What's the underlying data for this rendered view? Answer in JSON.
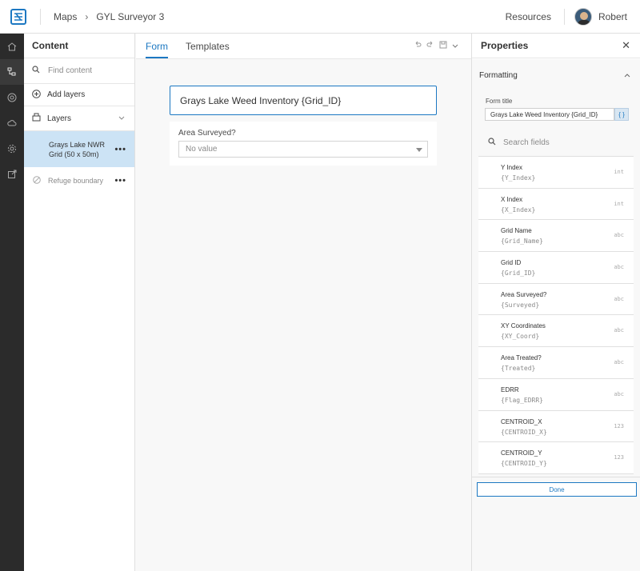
{
  "header": {
    "breadcrumb": [
      "Maps",
      "GYL Surveyor 3"
    ],
    "resources_label": "Resources",
    "username": "Robert"
  },
  "rail": {
    "icons": [
      "home-icon",
      "layers-icon",
      "target-icon",
      "cloud-icon",
      "gear-icon",
      "share-icon"
    ]
  },
  "content": {
    "title": "Content",
    "search_placeholder": "Find content",
    "add_layers_label": "Add layers",
    "layers_label": "Layers",
    "layers": [
      {
        "name": "Grays Lake NWR Grid (50 x 50m)",
        "selected": true
      },
      {
        "name": "Refuge boundary",
        "selected": false
      }
    ]
  },
  "form": {
    "tabs": [
      "Form",
      "Templates"
    ],
    "active_tab": "Form",
    "form_title": "Grays Lake Weed Inventory {Grid_ID}",
    "field_label": "Area Surveyed?",
    "field_value": "No value"
  },
  "properties": {
    "title": "Properties",
    "section": "Formatting",
    "form_title_label": "Form title",
    "form_title_value": "Grays Lake Weed Inventory {Grid_ID}",
    "expression_button": "{ }",
    "search_placeholder": "Search fields",
    "fields": [
      {
        "name": "Y Index",
        "expr": "{Y_Index}",
        "type": "int"
      },
      {
        "name": "X Index",
        "expr": "{X_Index}",
        "type": "int"
      },
      {
        "name": "Grid Name",
        "expr": "{Grid_Name}",
        "type": "abc"
      },
      {
        "name": "Grid ID",
        "expr": "{Grid_ID}",
        "type": "abc"
      },
      {
        "name": "Area Surveyed?",
        "expr": "{Surveyed}",
        "type": "abc"
      },
      {
        "name": "XY Coordinates",
        "expr": "{XY_Coord}",
        "type": "abc"
      },
      {
        "name": "Area Treated?",
        "expr": "{Treated}",
        "type": "abc"
      },
      {
        "name": "EDRR",
        "expr": "{Flag_EDRR}",
        "type": "abc"
      },
      {
        "name": "CENTROID_X",
        "expr": "{CENTROID_X}",
        "type": "123"
      },
      {
        "name": "CENTROID_Y",
        "expr": "{CENTROID_Y}",
        "type": "123"
      }
    ],
    "done_label": "Done"
  },
  "colors": {
    "accent": "#1c78c2",
    "rail": "#2b2b2b",
    "selected": "#cce3f5"
  }
}
